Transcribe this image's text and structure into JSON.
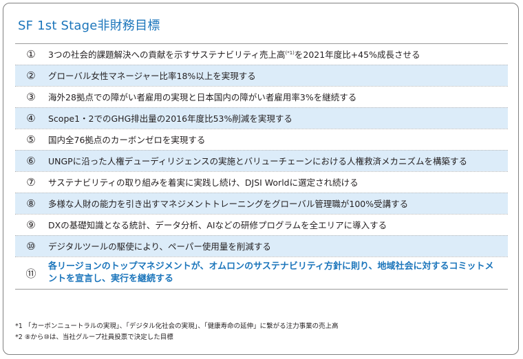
{
  "title": "SF 1st Stage非財務目標",
  "goals": [
    {
      "num": "①",
      "text_a": "3つの社会的課題解決への貢献を示すサステナビリティ売上高",
      "sup": "(*1)",
      "text_b": "を2021年度比+45%成長させる"
    },
    {
      "num": "②",
      "text": "グローバル女性マネージャー比率18%以上を実現する"
    },
    {
      "num": "③",
      "text": "海外28拠点での障がい者雇用の実現と日本国内の障がい者雇用率3%を継続する"
    },
    {
      "num": "④",
      "text": "Scope1・2でのGHG排出量の2016年度比53%削減を実現する"
    },
    {
      "num": "⑤",
      "text": "国内全76拠点のカーボンゼロを実現する"
    },
    {
      "num": "⑥",
      "text": "UNGPに沿った人権デューディリジェンスの実施とバリューチェーンにおける人権救済メカニズムを構築する"
    },
    {
      "num": "⑦",
      "text": "サステナビリティの取り組みを着実に実践し続け、DJSI Worldに選定され続ける"
    },
    {
      "num": "⑧",
      "text": "多様な人財の能力を引き出すマネジメントトレーニングをグローバル管理職が100%受講する"
    },
    {
      "num": "⑨",
      "text": "DXの基礎知識となる統計、データ分析、AIなどの研修プログラムを全エリアに導入する"
    },
    {
      "num": "⑩",
      "text": "デジタルツールの駆使により、ペーパー使用量を削減する"
    },
    {
      "num": "⑪",
      "text": "各リージョンのトップマネジメントが、オムロンのサステナビリティ方針に則り、地域社会に対するコミットメントを宣言し、実行を継続する"
    }
  ],
  "notes": {
    "note1": "*1 「カーボンニュートラルの実現」、「デジタル化社会の実現」、「健康寿命の延伸」に繋がる注力事業の売上高",
    "note2": "*2 ⑧から⑩は、当社グループ社員投票で決定した目標"
  },
  "colors": {
    "accent": "#1b75bb",
    "row_shade": "#dcecf9"
  }
}
